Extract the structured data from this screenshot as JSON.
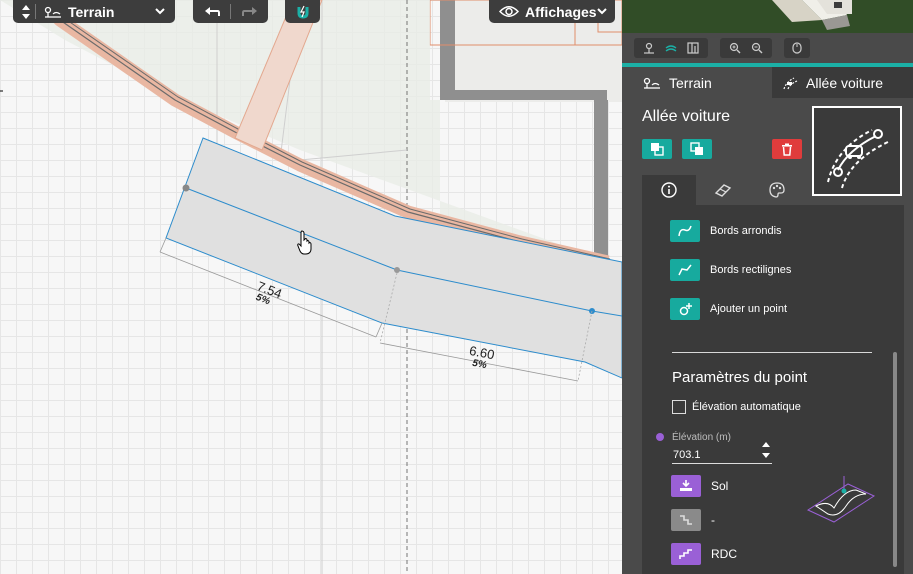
{
  "toolbar": {
    "level_label": "Terrain",
    "view_label": "Affichages"
  },
  "canvas": {
    "segments": [
      {
        "length": "7.54",
        "slope": "5%"
      },
      {
        "length": "6.60",
        "slope": "5%"
      }
    ]
  },
  "panel": {
    "tabs": [
      {
        "label": "Terrain"
      },
      {
        "label": "Allée voiture"
      }
    ],
    "object_title": "Allée voiture",
    "tools": [
      {
        "label": "Bords arrondis"
      },
      {
        "label": "Bords rectilignes"
      },
      {
        "label": "Ajouter un point"
      }
    ],
    "section_title": "Paramètres du point",
    "auto_elevation_label": "Élévation automatique",
    "elevation_label": "Élévation (m)",
    "elevation_value": "703.1",
    "elevation_buttons": [
      {
        "label": "Sol"
      },
      {
        "label": "-"
      },
      {
        "label": "RDC"
      }
    ]
  },
  "colors": {
    "accent": "#17aa9e",
    "delete": "#e03c3c",
    "elevation": "#9a60d6",
    "panel_bg": "#4a4a4a",
    "wall": "#e7b7a3"
  }
}
